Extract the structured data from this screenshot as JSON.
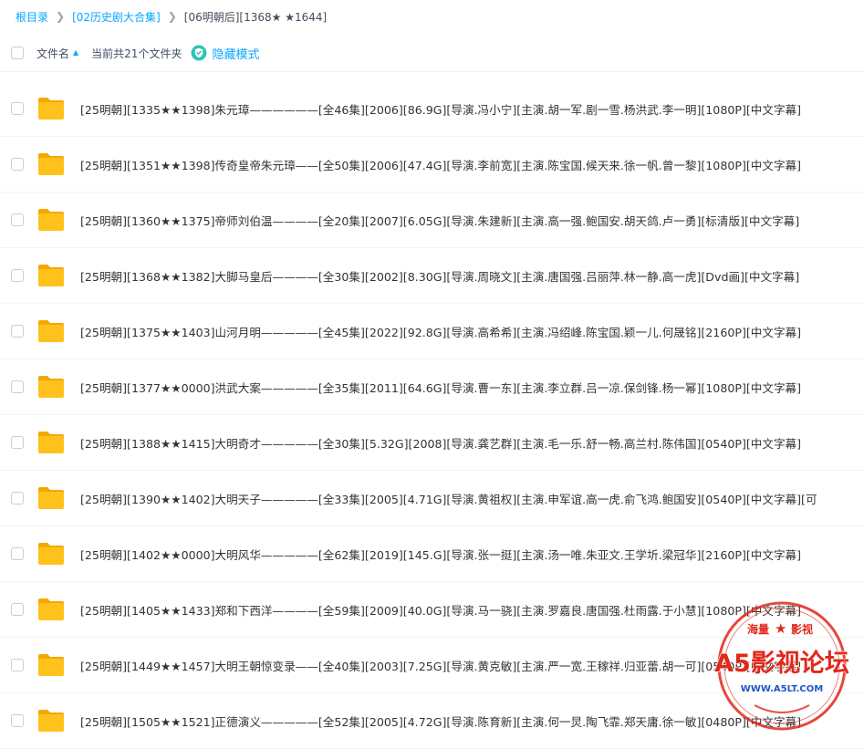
{
  "breadcrumb": {
    "root": "根目录",
    "parent": "[02历史剧大合集]",
    "current": "[06明朝后][1368★ ★1644]"
  },
  "list_header": {
    "sort_label": "文件名",
    "count_text": "当前共21个文件夹",
    "hide_mode": "隐藏模式"
  },
  "files": [
    {
      "name": "[25明朝][1335★★1398]朱元璋——————[全46集][2006][86.9G][导演.冯小宁][主演.胡一军.剧一雪.杨洪武.李一明][1080P][中文字幕]"
    },
    {
      "name": "[25明朝][1351★★1398]传奇皇帝朱元璋——[全50集][2006][47.4G][导演.李前宽][主演.陈宝国.候天来.徐一帆.曾一黎][1080P][中文字幕]"
    },
    {
      "name": "[25明朝][1360★★1375]帝师刘伯温————[全20集][2007][6.05G][导演.朱建新][主演.高一强.鲍国安.胡天鸽.卢一勇][标清版][中文字幕]"
    },
    {
      "name": "[25明朝][1368★★1382]大脚马皇后————[全30集][2002][8.30G][导演.周晓文][主演.唐国强.吕丽萍.林一静.高一虎][Dvd画][中文字幕]"
    },
    {
      "name": "[25明朝][1375★★1403]山河月明—————[全45集][2022][92.8G][导演.高希希][主演.冯绍峰.陈宝国.颖一儿.何晟铭][2160P][中文字幕]"
    },
    {
      "name": "[25明朝][1377★★0000]洪武大案—————[全35集][2011][64.6G][导演.曹一东][主演.李立群.吕一凉.保剑锋.杨一幂][1080P][中文字幕]"
    },
    {
      "name": "[25明朝][1388★★1415]大明奇才—————[全30集][5.32G][2008][导演.龚艺群][主演.毛一乐.舒一畅.高兰村.陈伟国][0540P][中文字幕]"
    },
    {
      "name": "[25明朝][1390★★1402]大明天子—————[全33集][2005][4.71G][导演.黄祖权][主演.申军谊.高一虎.俞飞鸿.鲍国安][0540P][中文字幕][可"
    },
    {
      "name": "[25明朝][1402★★0000]大明风华—————[全62集][2019][145.G][导演.张一挺][主演.汤一唯.朱亚文.王学圻.梁冠华][2160P][中文字幕]"
    },
    {
      "name": "[25明朝][1405★★1433]郑和下西洋————[全59集][2009][40.0G][导演.马一骁][主演.罗嘉良.唐国强.杜雨露.于小慧][1080P][中文字幕]"
    },
    {
      "name": "[25明朝][1449★★1457]大明王朝惊变录——[全40集][2003][7.25G][导演.黄克敏][主演.严一宽.王稼祥.归亚蕾.胡一可][0540P][中文字幕]"
    },
    {
      "name": "[25明朝][1505★★1521]正德演义—————[全52集][2005][4.72G][导演.陈育新][主演.何一炅.陶飞霏.郑天庸.徐一敏][0480P][中文字幕]"
    }
  ],
  "watermark": {
    "top_left": "海量",
    "top_right": "影视",
    "main": "A5影视论坛",
    "url": "WWW.A5LT.COM"
  },
  "colors": {
    "accent": "#06a7ff",
    "folder": "#ffc21c",
    "watermark_red": "#e0281b"
  }
}
